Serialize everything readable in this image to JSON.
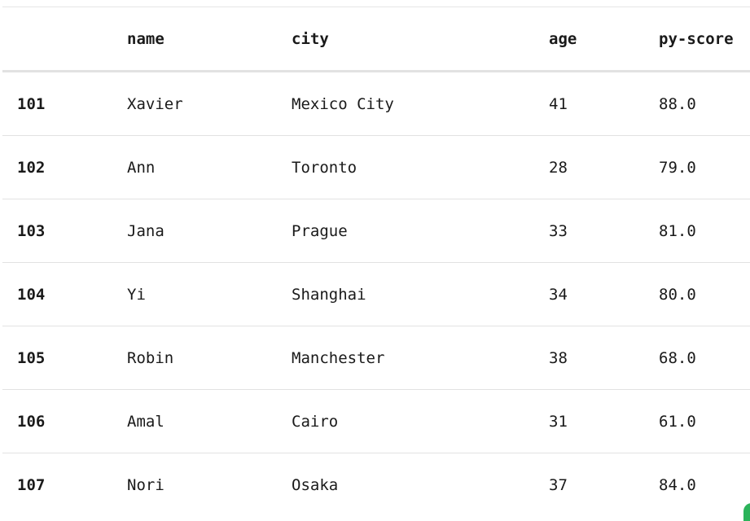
{
  "table": {
    "columns": [
      "",
      "name",
      "city",
      "age",
      "py-score"
    ],
    "rows": [
      {
        "id": "101",
        "name": "Xavier",
        "city": "Mexico City",
        "age": "41",
        "score": "88.0"
      },
      {
        "id": "102",
        "name": "Ann",
        "city": "Toronto",
        "age": "28",
        "score": "79.0"
      },
      {
        "id": "103",
        "name": "Jana",
        "city": "Prague",
        "age": "33",
        "score": "81.0"
      },
      {
        "id": "104",
        "name": "Yi",
        "city": "Shanghai",
        "age": "34",
        "score": "80.0"
      },
      {
        "id": "105",
        "name": "Robin",
        "city": "Manchester",
        "age": "38",
        "score": "68.0"
      },
      {
        "id": "106",
        "name": "Amal",
        "city": "Cairo",
        "age": "31",
        "score": "61.0"
      },
      {
        "id": "107",
        "name": "Nori",
        "city": "Osaka",
        "age": "37",
        "score": "84.0"
      }
    ]
  },
  "colors": {
    "accent_widget": "#2bb35a",
    "row_border": "#e2e2e2"
  }
}
